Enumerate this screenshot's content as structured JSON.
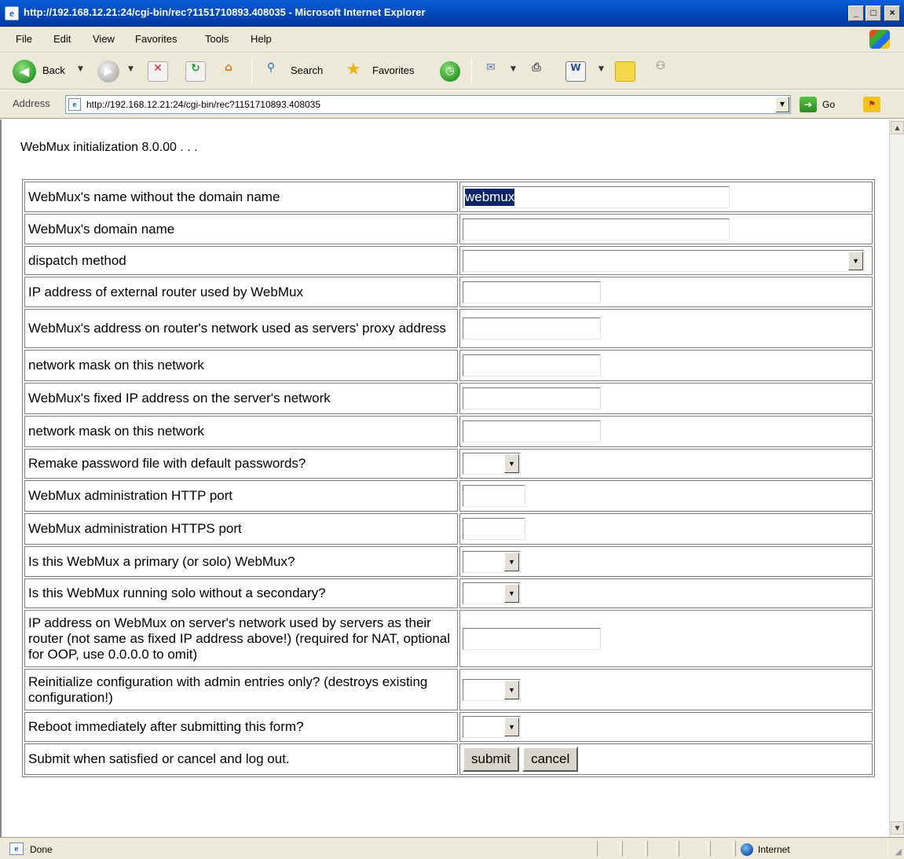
{
  "window": {
    "title": "http://192.168.12.21:24/cgi-bin/rec?1151710893.408035 - Microsoft Internet Explorer",
    "minimize": "_",
    "maximize": "□",
    "close": "×"
  },
  "menu": [
    "File",
    "Edit",
    "View",
    "Favorites",
    "Tools",
    "Help"
  ],
  "toolbar": {
    "back_label": "Back",
    "search_label": "Search",
    "favorites_label": "Favorites"
  },
  "address": {
    "label": "Address",
    "url": "http://192.168.12.21:24/cgi-bin/rec?1151710893.408035",
    "go_label": "Go"
  },
  "page": {
    "intro": "WebMux initialization 8.0.00 . . .",
    "rows": [
      {
        "label": "WebMux's name without the domain name",
        "type": "text",
        "value": "webmux"
      },
      {
        "label": "WebMux's domain name",
        "type": "text",
        "value": ""
      },
      {
        "label": "dispatch method",
        "type": "select",
        "value": ""
      },
      {
        "label": "IP address of external router used by WebMux",
        "type": "text",
        "value": ""
      },
      {
        "label": "WebMux's address on router's network used as servers' proxy address",
        "type": "text",
        "value": ""
      },
      {
        "label": "network mask on this network",
        "type": "text",
        "value": ""
      },
      {
        "label": "WebMux's fixed IP address on the server's network",
        "type": "text",
        "value": ""
      },
      {
        "label": "network mask on this network",
        "type": "text",
        "value": ""
      },
      {
        "label": "Remake password file with default passwords?",
        "type": "select",
        "value": ""
      },
      {
        "label": "WebMux administration HTTP port",
        "type": "text",
        "value": ""
      },
      {
        "label": "WebMux administration HTTPS port",
        "type": "text",
        "value": ""
      },
      {
        "label": "Is this WebMux a primary (or solo) WebMux?",
        "type": "select",
        "value": ""
      },
      {
        "label": "Is this WebMux running solo without a secondary?",
        "type": "select",
        "value": ""
      },
      {
        "label": "IP address on WebMux on server's network used by servers as their router (not same as fixed IP address above!) (required for NAT, optional for OOP, use 0.0.0.0 to omit)",
        "type": "text",
        "value": ""
      },
      {
        "label": "Reinitialize configuration with admin entries only? (destroys existing configuration!)",
        "type": "select",
        "value": ""
      },
      {
        "label": "Reboot immediately after submitting this form?",
        "type": "select",
        "value": ""
      },
      {
        "label": "Submit when satisfied or cancel and log out.",
        "type": "buttons"
      }
    ],
    "submit_label": "submit",
    "cancel_label": "cancel"
  },
  "status": {
    "text": "Done",
    "zone": "Internet"
  },
  "colors": {
    "titlebar": "#0054e3",
    "chrome": "#ece9d8",
    "selection": "#0a246a"
  }
}
